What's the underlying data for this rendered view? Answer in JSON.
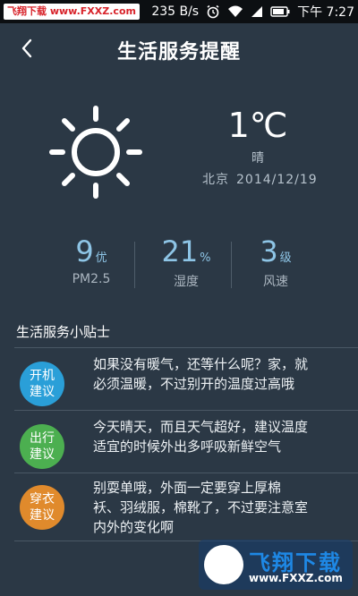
{
  "status_bar": {
    "watermark": "飞翔下载 www.FXXZ.com",
    "speed": "235 B/s",
    "time": "下午 7:27"
  },
  "header": {
    "back_icon": "chevron-left-icon",
    "title": "生活服务提醒"
  },
  "weather": {
    "icon": "sun-icon",
    "temperature": "1℃",
    "condition": "晴",
    "city": "北京",
    "date": "2014/12/19"
  },
  "stats": [
    {
      "value": "9",
      "unit": "优",
      "label": "PM2.5"
    },
    {
      "value": "21",
      "unit": "%",
      "label": "湿度"
    },
    {
      "value": "3",
      "unit": "级",
      "label": "风速"
    }
  ],
  "tips": {
    "title": "生活服务小贴士",
    "items": [
      {
        "badge_line1": "开机",
        "badge_line2": "建议",
        "color": "#2a9fd8",
        "line1": "如果没有暖气，还等什么呢？家，就",
        "line2": "必须温暖，不过别开的温度过高哦",
        "line3": ""
      },
      {
        "badge_line1": "出行",
        "badge_line2": "建议",
        "color": "#4caf50",
        "line1": "今天晴天，而且天气超好，建议温度",
        "line2": "适宜的时候外出多呼吸新鲜空气",
        "line3": ""
      },
      {
        "badge_line1": "穿衣",
        "badge_line2": "建议",
        "color": "#e08a2c",
        "line1": "别耍单哦，外面一定要穿上厚棉",
        "line2": "袄、羽绒服，棉靴了，不过要注意室",
        "line3": "内外的变化啊"
      }
    ]
  },
  "watermark_logo": {
    "text": "飞翔下载",
    "url": "www.FXXZ.com"
  }
}
